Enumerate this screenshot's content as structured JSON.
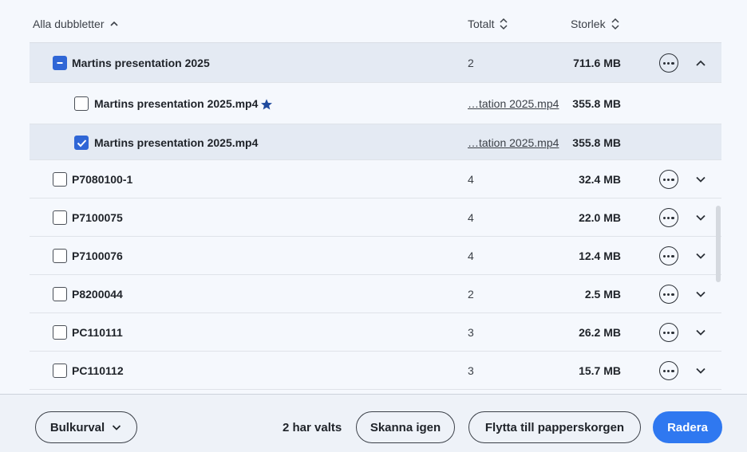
{
  "header": {
    "name_label": "Alla dubbletter",
    "count_label": "Totalt",
    "size_label": "Storlek"
  },
  "groups": [
    {
      "name": "Martins presentation 2025",
      "count": "2",
      "size": "711.6 MB",
      "state": "partial",
      "expanded": true,
      "files": [
        {
          "name": "Martins presentation 2025.mp4",
          "path": "…tation 2025.mp4",
          "size": "355.8 MB",
          "checked": false,
          "starred": true
        },
        {
          "name": "Martins presentation 2025.mp4",
          "path": "…tation 2025.mp4",
          "size": "355.8 MB",
          "checked": true,
          "starred": false
        }
      ]
    },
    {
      "name": "P7080100-1",
      "count": "4",
      "size": "32.4 MB",
      "state": "unchecked",
      "expanded": false
    },
    {
      "name": "P7100075",
      "count": "4",
      "size": "22.0 MB",
      "state": "unchecked",
      "expanded": false
    },
    {
      "name": "P7100076",
      "count": "4",
      "size": "12.4 MB",
      "state": "unchecked",
      "expanded": false
    },
    {
      "name": "P8200044",
      "count": "2",
      "size": "2.5 MB",
      "state": "unchecked",
      "expanded": false
    },
    {
      "name": "PC110111",
      "count": "3",
      "size": "26.2 MB",
      "state": "unchecked",
      "expanded": false
    },
    {
      "name": "PC110112",
      "count": "3",
      "size": "15.7 MB",
      "state": "unchecked",
      "expanded": false
    }
  ],
  "footer": {
    "bulk_label": "Bulkurval",
    "selected_text": "2 har valts",
    "rescan_label": "Skanna igen",
    "trash_label": "Flytta till papperskorgen",
    "delete_label": "Radera"
  },
  "colors": {
    "accent": "#2f78f0",
    "checkbox": "#2f66d6",
    "selected_row": "#e4eaf3",
    "star": "#1f4a9e"
  },
  "icons": {
    "sort_asc": "chevron-up-icon",
    "sort_both": "sort-icon",
    "more": "more-options-icon",
    "expand": "chevron-down-icon",
    "collapse": "chevron-up-icon",
    "star": "star-icon"
  }
}
